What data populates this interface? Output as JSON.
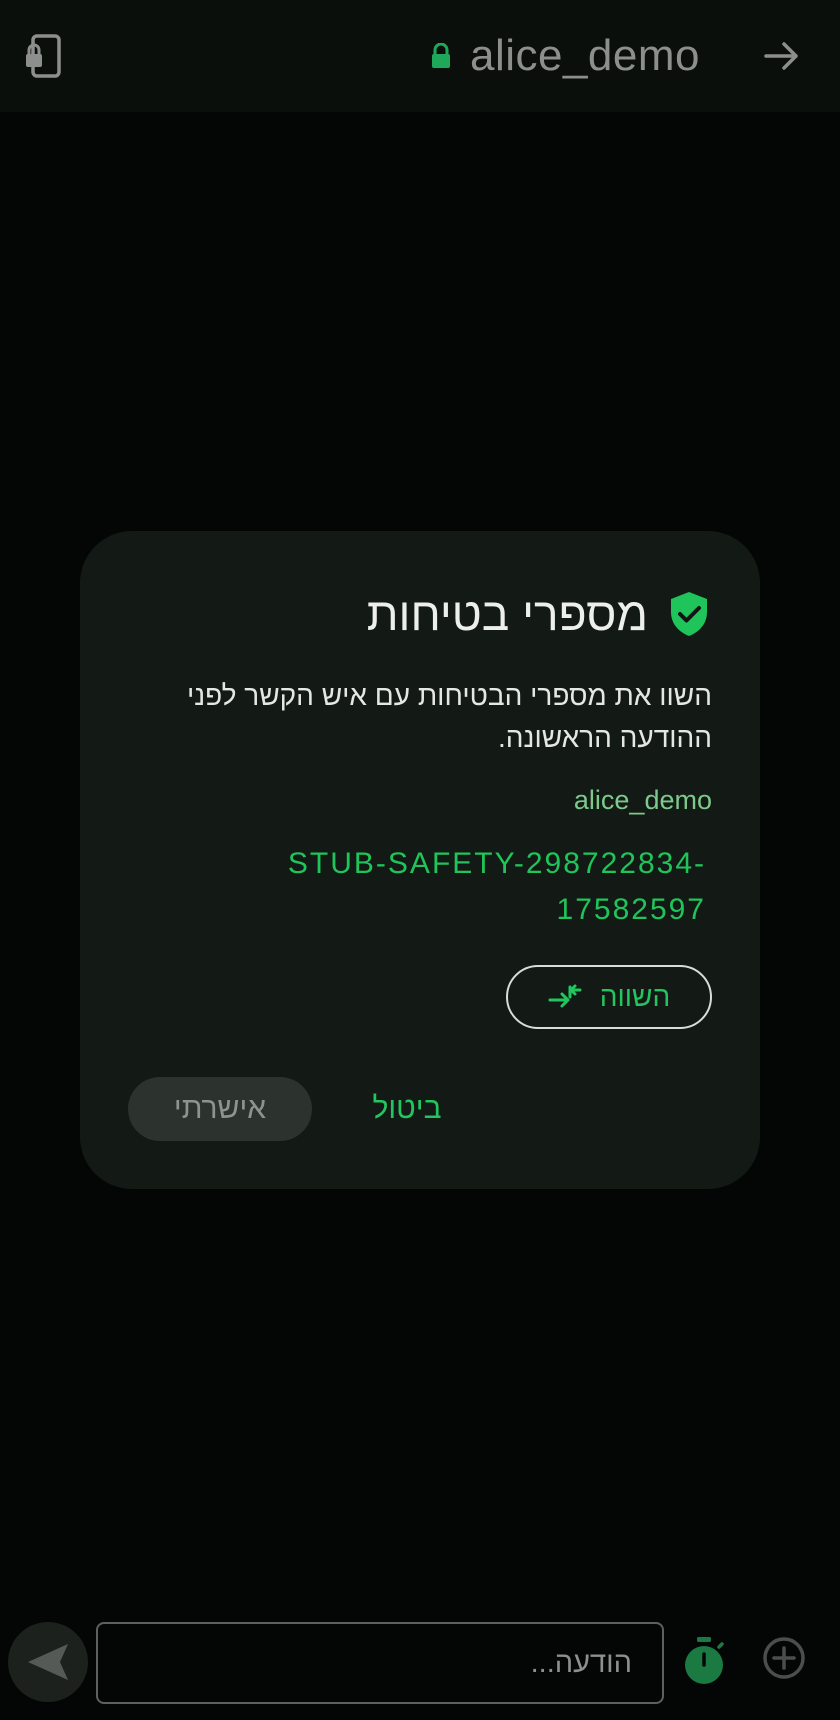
{
  "header": {
    "title": "alice_demo",
    "lock_icon": "lock-icon",
    "back_icon": "arrow-forward-icon",
    "device_icon": "device-lock-icon"
  },
  "dialog": {
    "title": "מספרי בטיחות",
    "shield_icon": "shield-check-icon",
    "description": "השוו את מספרי הבטיחות עם איש הקשר לפני ההודעה הראשונה.",
    "contact_name": "alice_demo",
    "safety_code": "STUB-SAFETY-298722834-17582597",
    "compare_label": "השווה",
    "compare_icon": "compare-arrows-icon",
    "cancel_label": "ביטול",
    "confirm_label": "אישרתי"
  },
  "composer": {
    "placeholder": "הודעה...",
    "send_icon": "send-icon",
    "timer_icon": "timer-icon",
    "add_icon": "add-circle-icon"
  },
  "colors": {
    "background": "#030604",
    "dialog": "#131a15",
    "accent": "#22c55e",
    "muted_text": "#8c8f8d"
  }
}
